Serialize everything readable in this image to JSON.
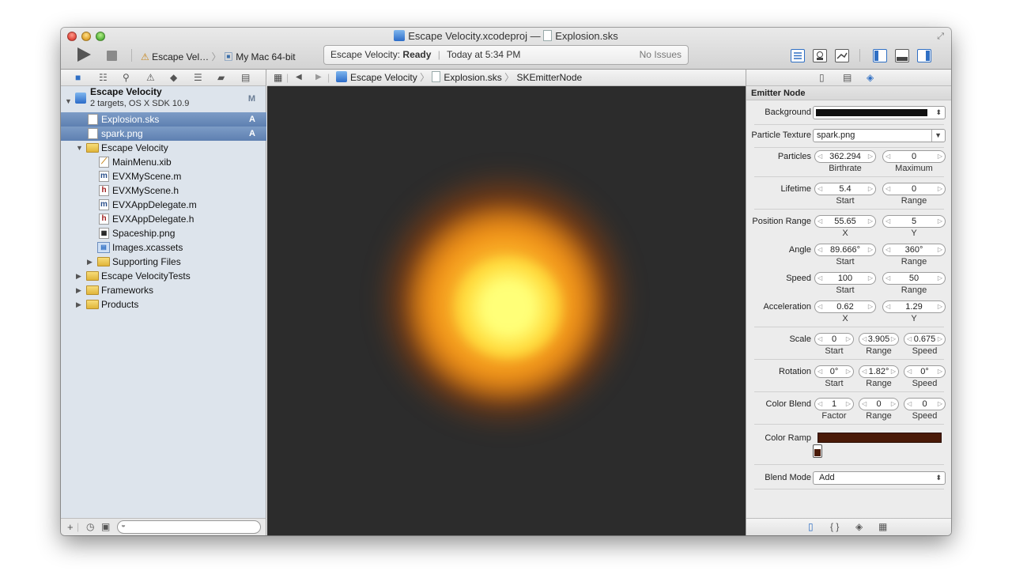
{
  "window": {
    "project_title": "Escape Velocity.xcodeproj",
    "title_separator": "—",
    "file_title": "Explosion.sks"
  },
  "toolbar": {
    "scheme_target": "Escape Vel…",
    "scheme_device": "My Mac 64-bit",
    "activity_project": "Escape Velocity:",
    "activity_status": "Ready",
    "activity_time": "Today at 5:34 PM",
    "activity_issues": "No Issues"
  },
  "navigator": {
    "project_name": "Escape Velocity",
    "project_subtitle": "2 targets, OS X SDK 10.9",
    "project_badge": "M",
    "items": [
      {
        "label": "Explosion.sks",
        "badge": "A",
        "icon": "sks-file-icon"
      },
      {
        "label": "spark.png",
        "badge": "A",
        "icon": "image-file-icon"
      },
      {
        "label": "Escape Velocity",
        "badge": "",
        "icon": "folder-icon"
      },
      {
        "label": "MainMenu.xib",
        "badge": "",
        "icon": "xib-file-icon"
      },
      {
        "label": "EVXMyScene.m",
        "badge": "",
        "icon": "m-file-icon"
      },
      {
        "label": "EVXMyScene.h",
        "badge": "",
        "icon": "h-file-icon"
      },
      {
        "label": "EVXAppDelegate.m",
        "badge": "",
        "icon": "m-file-icon"
      },
      {
        "label": "EVXAppDelegate.h",
        "badge": "",
        "icon": "h-file-icon"
      },
      {
        "label": "Spaceship.png",
        "badge": "",
        "icon": "image-file-icon"
      },
      {
        "label": "Images.xcassets",
        "badge": "",
        "icon": "asset-catalog-icon"
      },
      {
        "label": "Supporting Files",
        "badge": "",
        "icon": "folder-icon"
      },
      {
        "label": "Escape VelocityTests",
        "badge": "",
        "icon": "folder-icon"
      },
      {
        "label": "Frameworks",
        "badge": "",
        "icon": "folder-icon"
      },
      {
        "label": "Products",
        "badge": "",
        "icon": "folder-icon"
      }
    ]
  },
  "jumpbar": {
    "project": "Escape Velocity",
    "file": "Explosion.sks",
    "node": "SKEmitterNode"
  },
  "inspector": {
    "header": "Emitter Node",
    "background_label": "Background",
    "background_color": "#111111",
    "texture_label": "Particle Texture",
    "texture_value": "spark.png",
    "particles_label": "Particles",
    "birthrate": "362.294",
    "birthrate_sub": "Birthrate",
    "maximum": "0",
    "maximum_sub": "Maximum",
    "lifetime_label": "Lifetime",
    "lifetime_start": "5.4",
    "lifetime_range": "0",
    "start_sub": "Start",
    "range_sub": "Range",
    "speed_sub": "Speed",
    "x_sub": "X",
    "y_sub": "Y",
    "factor_sub": "Factor",
    "position_label": "Position Range",
    "position_x": "55.65",
    "position_y": "5",
    "angle_label": "Angle",
    "angle_start": "89.666°",
    "angle_range": "360°",
    "speed_label": "Speed",
    "speed_start": "100",
    "speed_range": "50",
    "accel_label": "Acceleration",
    "accel_x": "0.62",
    "accel_y": "1.29",
    "scale_label": "Scale",
    "scale_start": "0",
    "scale_range": "3.905",
    "scale_speed": "0.675",
    "rotation_label": "Rotation",
    "rotation_start": "0°",
    "rotation_range": "1.82°",
    "rotation_speed": "0°",
    "colorblend_label": "Color Blend",
    "colorblend_factor": "1",
    "colorblend_range": "0",
    "colorblend_speed": "0",
    "colorramp_label": "Color Ramp",
    "colorramp_color": "#4a1a08",
    "blendmode_label": "Blend Mode",
    "blendmode_value": "Add"
  }
}
